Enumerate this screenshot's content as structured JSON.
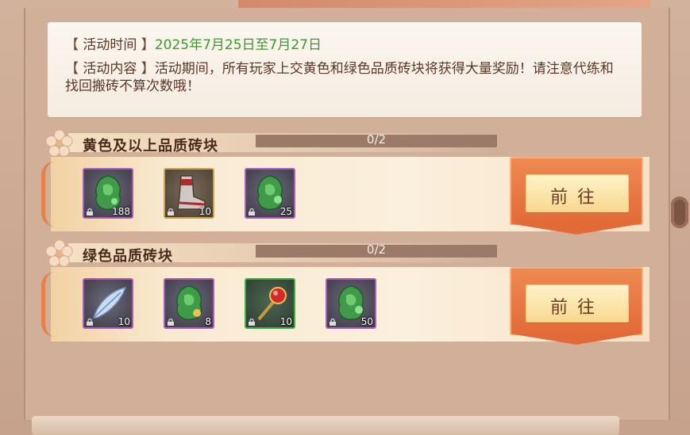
{
  "notice": {
    "time_label": "活动时间",
    "time_value": "2025年7月25日至7月27日",
    "content_label": "活动内容",
    "content_text": "活动期间，所有玩家上交黄色和绿色品质砖块将获得大量奖励！请注意代练和找回搬砖不算次数哦！"
  },
  "sections": [
    {
      "title": "黄色及以上品质砖块",
      "progress_text": "0/2",
      "progress": 0,
      "button_label": "前往",
      "items": [
        {
          "icon": "jade-pendant-icon",
          "count": "188",
          "frame": "purple"
        },
        {
          "icon": "armored-boot-icon",
          "count": "10",
          "frame": "gold"
        },
        {
          "icon": "jade-pendant-icon",
          "count": "25",
          "frame": "purple"
        }
      ]
    },
    {
      "title": "绿色品质砖块",
      "progress_text": "0/2",
      "progress": 0,
      "button_label": "前往",
      "items": [
        {
          "icon": "feather-icon",
          "count": "10",
          "frame": "purple"
        },
        {
          "icon": "jade-pendant-icon",
          "count": "8",
          "frame": "purple"
        },
        {
          "icon": "ruby-wand-icon",
          "count": "10",
          "frame": "green"
        },
        {
          "icon": "jade-pendant-icon",
          "count": "50",
          "frame": "purple"
        }
      ]
    }
  ],
  "colors": {
    "accent_green": "#3a9a2a",
    "button_orange": "#e26a37",
    "frame_purple": "#a95fb9",
    "frame_gold": "#c9a54a",
    "frame_green": "#3eae40"
  }
}
